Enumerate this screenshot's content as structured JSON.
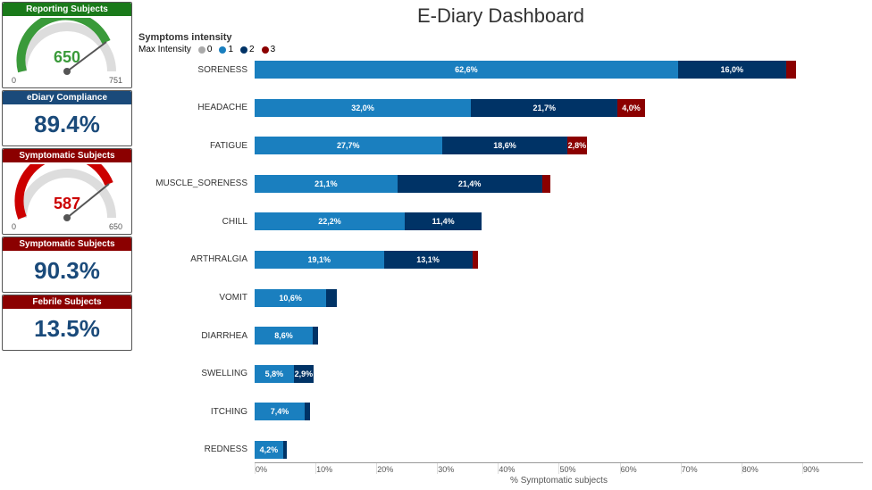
{
  "title": "E-Diary Dashboard",
  "sidebar": {
    "reporting_subjects": {
      "title": "Reporting Subjects",
      "value": "650",
      "min": "0",
      "max": "751",
      "percent": 86.5,
      "color": "green"
    },
    "ediary_compliance": {
      "title": "eDiary Compliance",
      "value": "89.4%"
    },
    "symptomatic_subjects_1": {
      "title": "Symptomatic Subjects",
      "value": "587",
      "min": "0",
      "max": "650",
      "percent": 90.3,
      "color": "red"
    },
    "symptomatic_subjects_2": {
      "title": "Symptomatic Subjects",
      "value": "90.3%"
    },
    "febrile_subjects": {
      "title": "Febrile Subjects",
      "value": "13.5%"
    }
  },
  "chart": {
    "intensity_label": "Symptoms intensity",
    "max_intensity_label": "Max Intensity",
    "legend": [
      {
        "label": "0",
        "color": "#aaa"
      },
      {
        "label": "1",
        "color": "#1a7fbf"
      },
      {
        "label": "2",
        "color": "#003366"
      },
      {
        "label": "3",
        "color": "#8b0000"
      }
    ],
    "x_axis_label": "% Symptomatic subjects",
    "x_ticks": [
      "0%",
      "10%",
      "20%",
      "30%",
      "40%",
      "50%",
      "60%",
      "70%",
      "80%",
      "90%"
    ],
    "bars": [
      {
        "label": "SORENESS",
        "seg0": 62.6,
        "seg1": 16.0,
        "seg2": 1.5,
        "label0": "62,6%",
        "label1": "16,0%",
        "label2": ""
      },
      {
        "label": "HEADACHE",
        "seg0": 32.0,
        "seg1": 21.7,
        "seg2": 4.0,
        "label0": "32,0%",
        "label1": "21,7%",
        "label2": "4,0%"
      },
      {
        "label": "FATIGUE",
        "seg0": 27.7,
        "seg1": 18.6,
        "seg2": 2.8,
        "label0": "27,7%",
        "label1": "18,6%",
        "label2": "2,8%"
      },
      {
        "label": "MUSCLE_SORENESS",
        "seg0": 21.1,
        "seg1": 21.4,
        "seg2": 1.2,
        "label0": "21,1%",
        "label1": "21,4%",
        "label2": ""
      },
      {
        "label": "CHILL",
        "seg0": 22.2,
        "seg1": 11.4,
        "seg2": 0,
        "label0": "22,2%",
        "label1": "11,4%",
        "label2": ""
      },
      {
        "label": "ARTHRALGIA",
        "seg0": 19.1,
        "seg1": 13.1,
        "seg2": 0.8,
        "label0": "19,1%",
        "label1": "13,1%",
        "label2": ""
      },
      {
        "label": "VOMIT",
        "seg0": 10.6,
        "seg1": 1.5,
        "seg2": 0,
        "label0": "10,6%",
        "label1": "",
        "label2": ""
      },
      {
        "label": "DIARRHEA",
        "seg0": 8.6,
        "seg1": 0.8,
        "seg2": 0,
        "label0": "8,6%",
        "label1": "",
        "label2": ""
      },
      {
        "label": "SWELLING",
        "seg0": 5.8,
        "seg1": 2.9,
        "seg2": 0,
        "label0": "5,8%",
        "label1": "2,9%",
        "label2": ""
      },
      {
        "label": "ITCHING",
        "seg0": 7.4,
        "seg1": 0.8,
        "seg2": 0,
        "label0": "7,4%",
        "label1": "",
        "label2": ""
      },
      {
        "label": "REDNESS",
        "seg0": 4.2,
        "seg1": 0.5,
        "seg2": 0,
        "label0": "4,2%",
        "label1": "",
        "label2": ""
      }
    ],
    "max_x": 90
  }
}
